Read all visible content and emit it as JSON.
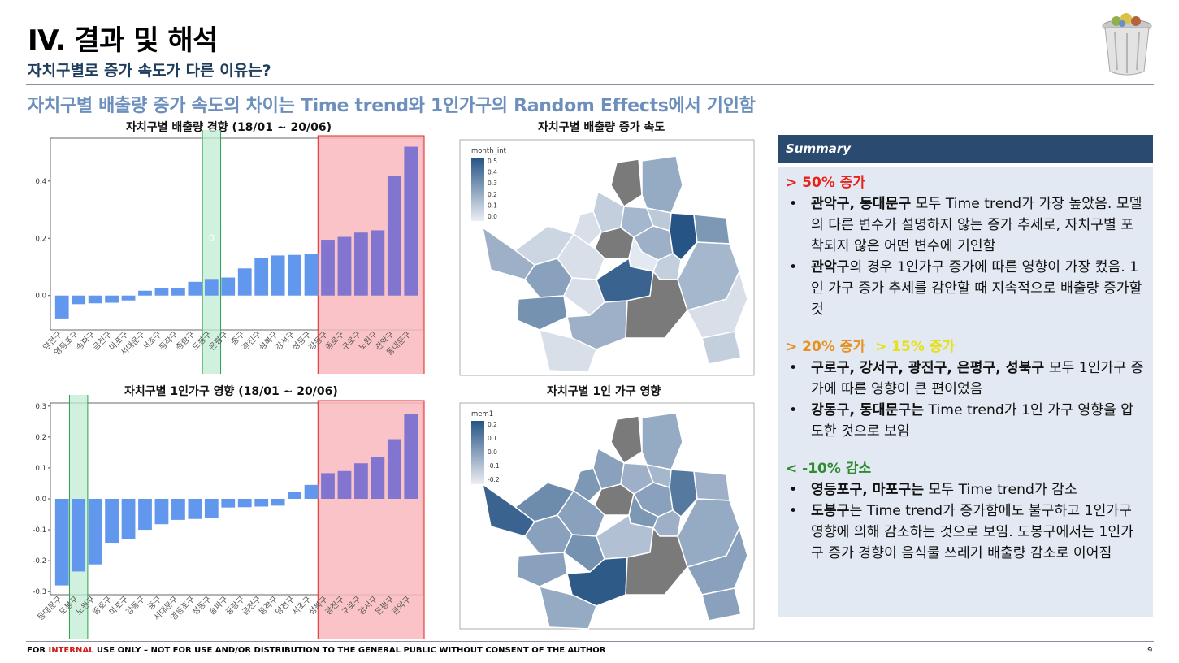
{
  "header": {
    "title": "IV. 결과 및 해석",
    "subtitle": "자치구별로 증가 속도가 다른 이유는?",
    "headline": "자치구별 배출량 증가 속도의 차이는 Time trend와 1인가구의 Random Effects에서 기인함"
  },
  "colors": {
    "bar_blue": "#6297ee",
    "bar_purple": "#8175cf",
    "highlight_red": "#f9b9bd",
    "highlight_green": "#c2ecd4",
    "summary_header": "#2b4a6f",
    "summary_bg": "#e2e9f2"
  },
  "chart_data": [
    {
      "type": "bar",
      "title": "자치구별 배출량 경향 (18/01 ~ 20/06)",
      "categories": [
        "양천구",
        "영등포구",
        "송파구",
        "금천구",
        "마포구",
        "서대문구",
        "서초구",
        "동작구",
        "중랑구",
        "도봉구",
        "은평구",
        "중구",
        "광진구",
        "성북구",
        "강서구",
        "성동구",
        "강동구",
        "종로구",
        "구로구",
        "노원구",
        "관악구",
        "동대문구"
      ],
      "values": [
        -0.08,
        -0.03,
        -0.027,
        -0.025,
        -0.017,
        0.017,
        0.025,
        0.025,
        0.048,
        0.058,
        0.063,
        0.095,
        0.13,
        0.14,
        0.142,
        0.145,
        0.195,
        0.205,
        0.22,
        0.228,
        0.418,
        0.52
      ],
      "ylim": [
        -0.12,
        0.55
      ],
      "yticks": [
        0.0,
        0.2,
        0.4
      ],
      "ytick_labels": [
        "0.0",
        "0.2",
        "0.4"
      ],
      "highlight_red_from": 16,
      "highlight_green_index": 9,
      "annotation": "0"
    },
    {
      "type": "bar",
      "title": "자치구별 1인가구 영향 (18/01 ~ 20/06)",
      "categories": [
        "동대문구",
        "도봉구",
        "노원구",
        "종로구",
        "마포구",
        "강동구",
        "중구",
        "서대문구",
        "영등포구",
        "성동구",
        "송파구",
        "중랑구",
        "금천구",
        "동작구",
        "양천구",
        "서초구",
        "성북구",
        "광진구",
        "구로구",
        "강서구",
        "은평구",
        "관악구"
      ],
      "values": [
        -0.28,
        -0.235,
        -0.212,
        -0.142,
        -0.13,
        -0.1,
        -0.082,
        -0.068,
        -0.065,
        -0.062,
        -0.028,
        -0.027,
        -0.025,
        -0.022,
        0.022,
        0.045,
        0.083,
        0.09,
        0.115,
        0.135,
        0.193,
        0.275
      ],
      "ylim": [
        -0.31,
        0.31
      ],
      "yticks": [
        -0.3,
        -0.2,
        -0.1,
        0.0,
        0.1,
        0.2,
        0.3
      ],
      "ytick_labels": [
        "-0.3",
        "-0.2",
        "-0.1",
        "0.0",
        "0.1",
        "0.2",
        "0.3"
      ],
      "highlight_red_from": 16,
      "highlight_green_index": 1
    },
    {
      "type": "heatmap",
      "title": "자치구별 배출량 증가 속도",
      "legend_title": "month_int",
      "legend_labels": [
        "0.5",
        "0.4",
        "0.3",
        "0.2",
        "0.1",
        "0.0"
      ]
    },
    {
      "type": "heatmap",
      "title": "자치구별 1인 가구 영향",
      "legend_title": "mem1",
      "legend_labels": [
        "0.2",
        "0.1",
        "0.0",
        "-0.1",
        "-0.2"
      ]
    }
  ],
  "summary": {
    "header": "Summary",
    "s1": {
      "head": "> 50%  증가",
      "b1_bold": "관악구, 동대문구",
      "b1_text": " 모두 Time trend가 가장 높았음. 모델의 다른 변수가 설명하지 않는 증가 추세로, 자치구별 포착되지 않은 어떤 변수에 기인함",
      "b2_bold": "관악구",
      "b2_text": "의 경우 1인가구 증가에 따른 영향이 가장 컸음. 1인 가구 증가 추세를 감안할 때 지속적으로 배출량 증가할 것"
    },
    "s2": {
      "head_a": "> 20% 증가",
      "head_b": "> 15% 증가",
      "b1_bold": "구로구, 강서구, 광진구, 은평구, 성북구",
      "b1_text": " 모두 1인가구 증가에 따른 영향이 큰 편이었음",
      "b2_bold": "강동구, 동대문구는",
      "b2_text": " Time trend가 1인 가구 영향을 압도한 것으로 보임"
    },
    "s3": {
      "head": "< -10% 감소",
      "b1_bold": "영등포구, 마포구는",
      "b1_text": " 모두 Time trend가 감소",
      "b2_bold": "도봉구",
      "b2_text": "는 Time trend가 증가함에도 불구하고 1인가구 영향에 의해 감소하는 것으로 보임. 도봉구에서는 1인가구 증가 경향이 음식물 쓰레기 배출량 감소로 이어짐"
    }
  },
  "footer": {
    "text_a": "FOR ",
    "text_red": "INTERNAL",
    "text_b": " USE ONLY – NOT FOR USE AND/OR DISTRIBUTION TO THE GENERAL PUBLIC WITHOUT CONSENT OF THE AUTHOR",
    "page": "9"
  }
}
